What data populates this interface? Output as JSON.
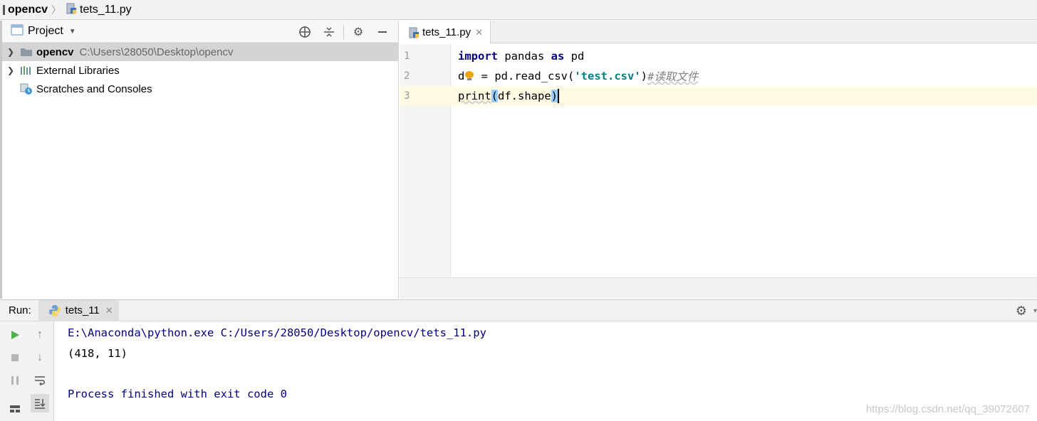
{
  "breadcrumb": {
    "project": "opencv",
    "file": "tets_11.py"
  },
  "project_panel": {
    "title": "Project",
    "tree": [
      {
        "label": "opencv",
        "path": "C:\\Users\\28050\\Desktop\\opencv",
        "icon": "folder-icon"
      },
      {
        "label": "External Libraries",
        "icon": "libraries-icon"
      },
      {
        "label": "Scratches and Consoles",
        "icon": "scratches-icon"
      }
    ]
  },
  "editor": {
    "tab_label": "tets_11.py",
    "line_numbers": [
      "1",
      "2",
      "3"
    ],
    "lines": {
      "l1": {
        "kw1": "import",
        "t1": " pandas ",
        "kw2": "as",
        "t2": " pd"
      },
      "l2": {
        "a": "d",
        "b": " = pd.read_csv(",
        "str": "'test.csv'",
        "c": ")",
        "comment": "#读取文件"
      },
      "l3": {
        "fn": "print",
        "p1": "(",
        "args": "df.shape",
        "p2": ")"
      }
    }
  },
  "run_panel": {
    "label": "Run:",
    "tab_label": "tets_11",
    "console": [
      "E:\\Anaconda\\python.exe C:/Users/28050/Desktop/opencv/tets_11.py",
      "(418, 11)",
      "",
      "Process finished with exit code 0"
    ]
  },
  "watermark": "https://blog.csdn.net/qq_39072607"
}
